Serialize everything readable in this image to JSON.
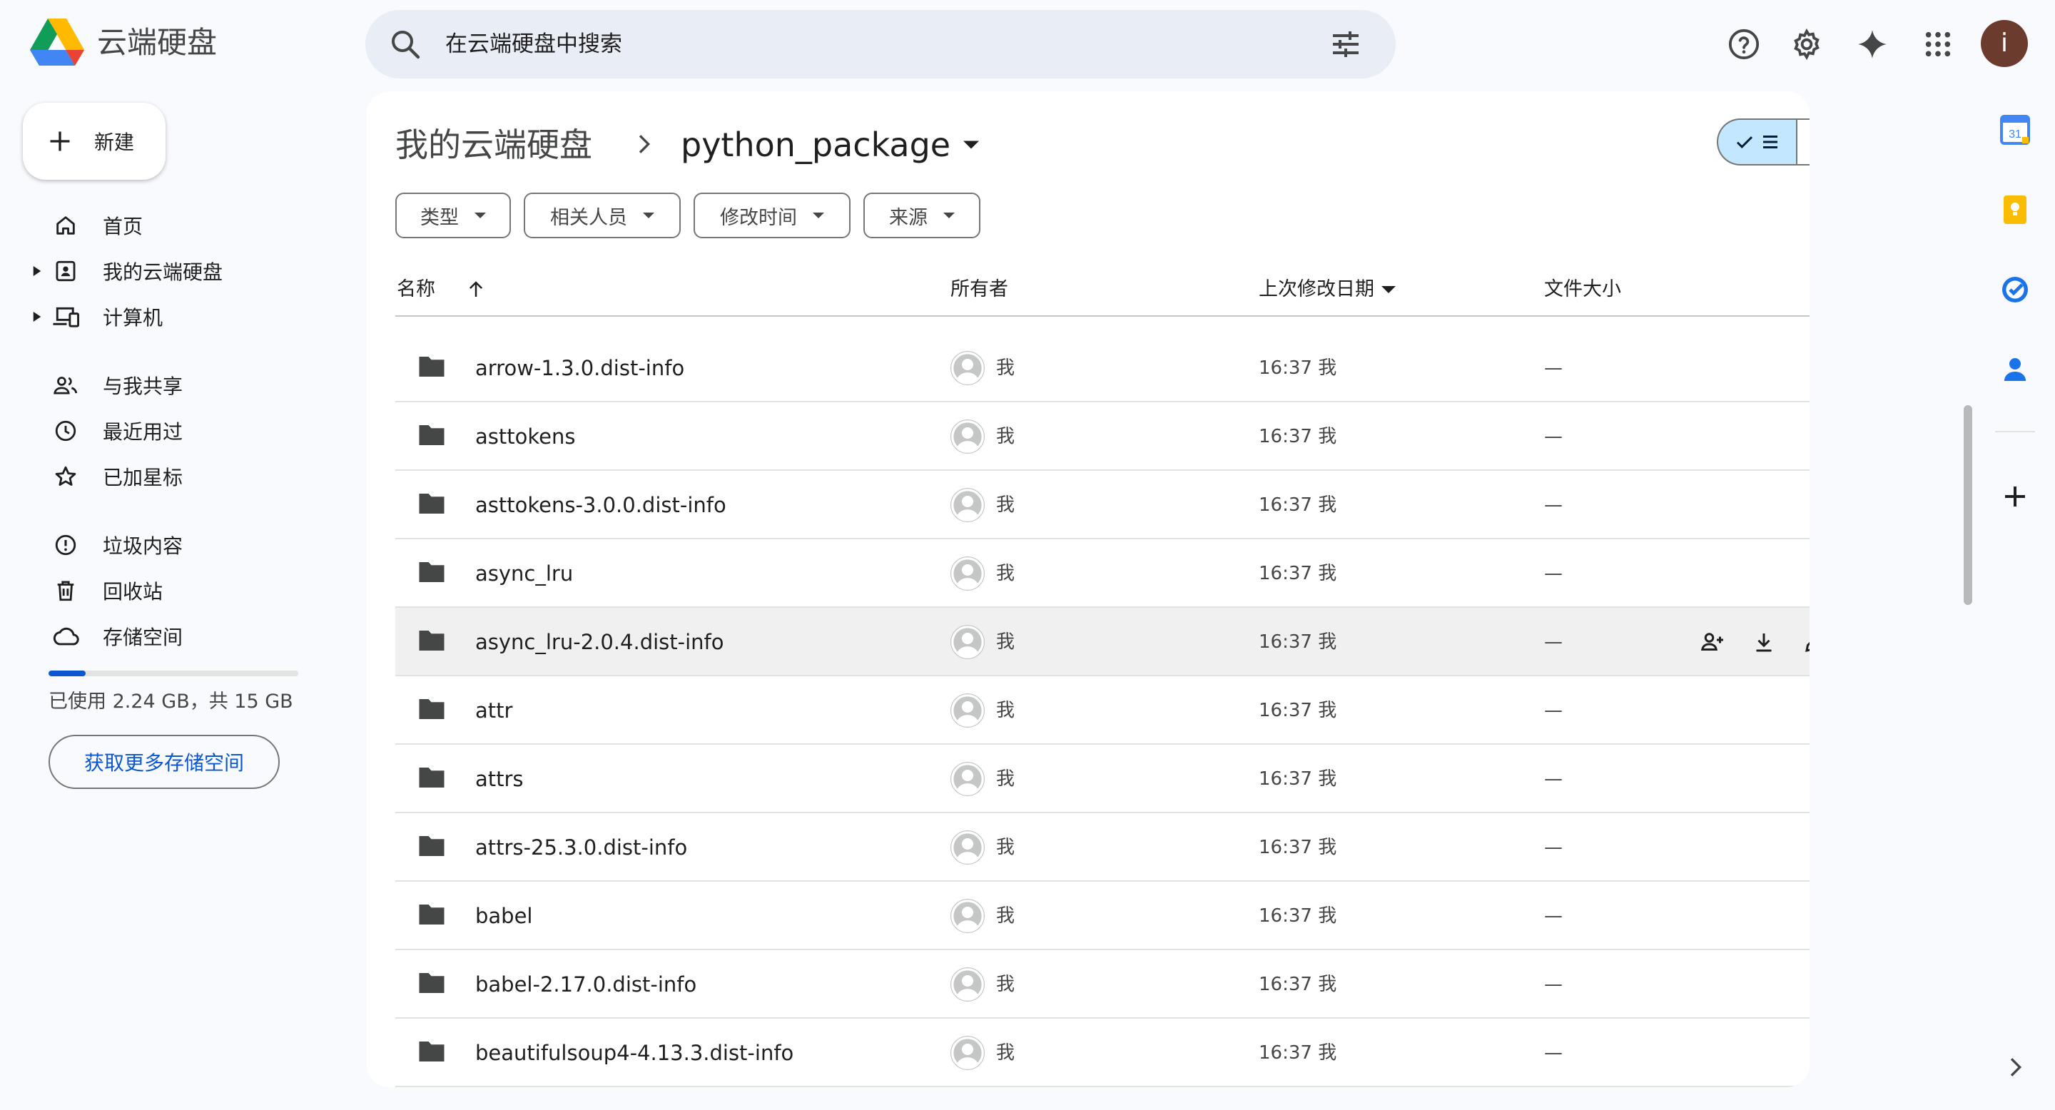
{
  "app": {
    "title": "云端硬盘"
  },
  "search": {
    "placeholder": "在云端硬盘中搜索"
  },
  "account": {
    "avatar_letter": "i"
  },
  "new_button": {
    "label": "新建"
  },
  "nav": {
    "items": [
      {
        "label": "首页",
        "icon": "home-icon",
        "expandable": false
      },
      {
        "label": "我的云端硬盘",
        "icon": "my-drive-icon",
        "expandable": true
      },
      {
        "label": "计算机",
        "icon": "computers-icon",
        "expandable": true
      },
      {
        "label": "与我共享",
        "icon": "shared-icon",
        "expandable": false
      },
      {
        "label": "最近用过",
        "icon": "clock-icon",
        "expandable": false
      },
      {
        "label": "已加星标",
        "icon": "star-icon",
        "expandable": false
      },
      {
        "label": "垃圾内容",
        "icon": "spam-icon",
        "expandable": false
      },
      {
        "label": "回收站",
        "icon": "trash-icon",
        "expandable": false
      },
      {
        "label": "存储空间",
        "icon": "cloud-icon",
        "expandable": false
      }
    ]
  },
  "storage": {
    "used_fraction": 0.149,
    "text": "已使用 2.24 GB，共 15 GB",
    "button": "获取更多存储空间",
    "accent": "#0b57d0"
  },
  "breadcrumb": {
    "root": "我的云端硬盘",
    "current": "python_package"
  },
  "view": {
    "selected": "list"
  },
  "filters": {
    "chips": [
      "类型",
      "相关人员",
      "修改时间",
      "来源"
    ]
  },
  "columns": {
    "name": "名称",
    "owner": "所有者",
    "modified": "上次修改日期",
    "size": "文件大小"
  },
  "files": [
    {
      "name": "arrow-1.3.0.dist-info",
      "owner": "我",
      "modified": "16:37 我",
      "size": "—"
    },
    {
      "name": "asttokens",
      "owner": "我",
      "modified": "16:37 我",
      "size": "—"
    },
    {
      "name": "asttokens-3.0.0.dist-info",
      "owner": "我",
      "modified": "16:37 我",
      "size": "—"
    },
    {
      "name": "async_lru",
      "owner": "我",
      "modified": "16:37 我",
      "size": "—"
    },
    {
      "name": "async_lru-2.0.4.dist-info",
      "owner": "我",
      "modified": "16:37 我",
      "size": "—",
      "hovered": true
    },
    {
      "name": "attr",
      "owner": "我",
      "modified": "16:37 我",
      "size": "—"
    },
    {
      "name": "attrs",
      "owner": "我",
      "modified": "16:37 我",
      "size": "—"
    },
    {
      "name": "attrs-25.3.0.dist-info",
      "owner": "我",
      "modified": "16:37 我",
      "size": "—"
    },
    {
      "name": "babel",
      "owner": "我",
      "modified": "16:37 我",
      "size": "—"
    },
    {
      "name": "babel-2.17.0.dist-info",
      "owner": "我",
      "modified": "16:37 我",
      "size": "—"
    },
    {
      "name": "beautifulsoup4-4.13.3.dist-info",
      "owner": "我",
      "modified": "16:37 我",
      "size": "—"
    }
  ],
  "side_panel": {
    "calendar_day": "31"
  }
}
